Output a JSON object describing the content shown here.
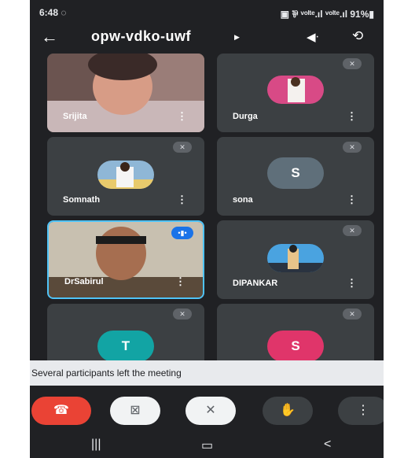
{
  "status_bar": {
    "time": "6:48 ◌",
    "right": "▣ ⅌ ᵛᵒˡᵗᵉ.ıl ᵛᵒˡᵗᵉ.ıl 91%▮"
  },
  "top_bar": {
    "meeting_code": "opw-vdko-uwf"
  },
  "participants": [
    {
      "name": "Srijita"
    },
    {
      "name": "Durga"
    },
    {
      "name": "Somnath"
    },
    {
      "name": "sona",
      "initial": "S"
    },
    {
      "name": "DrSabirul"
    },
    {
      "name": "DIPANKAR"
    },
    {
      "name": "",
      "initial": "T"
    },
    {
      "name": "",
      "initial": "S"
    }
  ],
  "toast": {
    "message": "Several participants left the meeting"
  },
  "colors": {
    "background": "#202124",
    "tile": "#3c4043",
    "end_call": "#ea4335",
    "avatar_s_gray": "#5f6f7a",
    "avatar_t": "#12a4a4",
    "avatar_s_pink": "#e0356a",
    "speaking_border": "#4fc3f7"
  },
  "icons": {
    "back": "arrow-left-icon",
    "speaker": "speaker-icon",
    "switch_camera": "switch-camera-icon",
    "muted": "mic-off-icon",
    "end_call": "phone-hangup-icon",
    "camera_off": "video-off-icon",
    "mic_off": "mic-off-icon",
    "raise_hand": "hand-icon",
    "more": "more-vert-icon"
  }
}
